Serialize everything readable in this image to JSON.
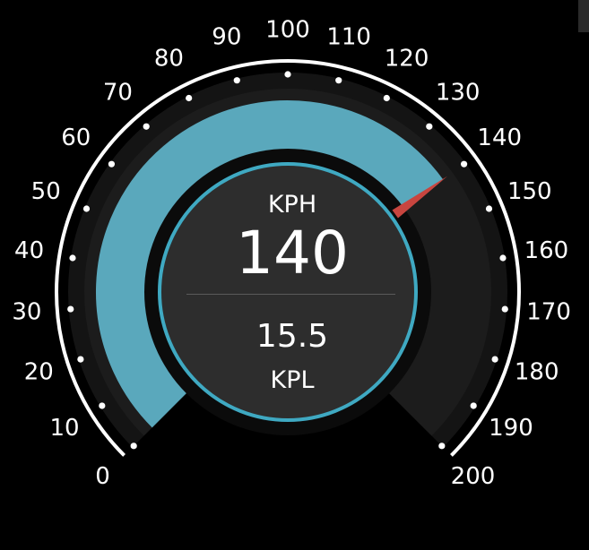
{
  "gauge": {
    "min": 0,
    "max": 200,
    "tick_labels": [
      "0",
      "10",
      "20",
      "30",
      "40",
      "50",
      "60",
      "70",
      "80",
      "90",
      "100",
      "110",
      "120",
      "130",
      "140",
      "150",
      "160",
      "170",
      "180",
      "190",
      "200"
    ],
    "highlighted_tick": "60",
    "speed": 140,
    "speed_display": "140",
    "speed_unit": "KPH",
    "economy_display": "15.5",
    "economy_unit": "KPL"
  },
  "colors": {
    "background": "#000000",
    "arc_fill": "#5aa8bc",
    "arc_track": "#1c1c1c",
    "ring": "#ffffff",
    "needle": "#c8453f",
    "hub_border": "#3fa9c2",
    "hub_fill": "#2d2d2d",
    "highlighted_tick_color": "#bdbdbd"
  },
  "icons": {
    "needle": "needle-icon"
  }
}
